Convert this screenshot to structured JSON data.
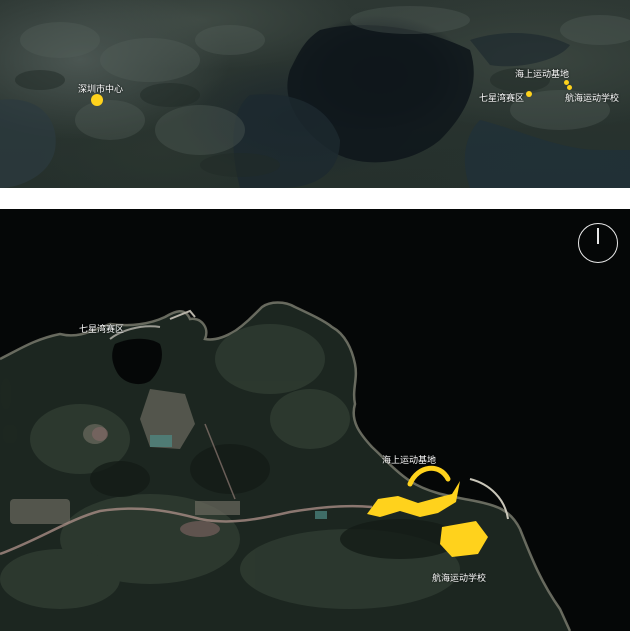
{
  "top_map": {
    "labels": {
      "shenzhen_center": "深圳市中心",
      "offshore_base": "海上运动基地",
      "qixingwan": "七星湾赛区",
      "nautical_school": "航海运动学校"
    }
  },
  "bottom_map": {
    "labels": {
      "qixingwan": "七星湾赛区",
      "offshore_base": "海上运动基地",
      "nautical_school": "航海运动学校"
    },
    "compass": "north-arrow-icon"
  },
  "colors": {
    "highlight": "#ffd21c",
    "label": "#ffffff",
    "sea": "#050707",
    "divider": "#ffffff"
  }
}
